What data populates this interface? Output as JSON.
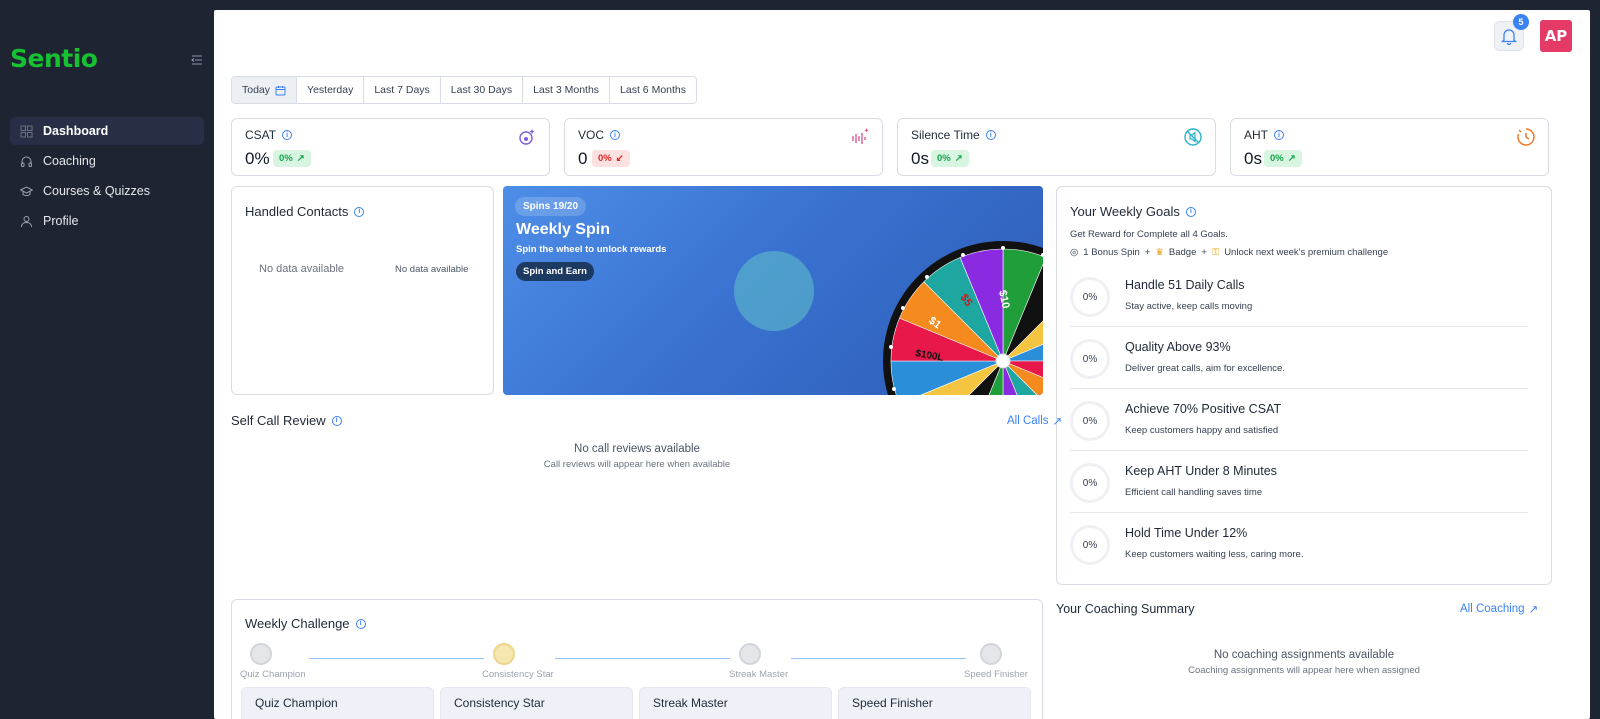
{
  "app": {
    "logo": "Sentio"
  },
  "sidebar": {
    "items": [
      {
        "label": "Dashboard"
      },
      {
        "label": "Coaching"
      },
      {
        "label": "Courses & Quizzes"
      },
      {
        "label": "Profile"
      }
    ]
  },
  "header": {
    "notifications_count": "5",
    "avatar_initials": "AP"
  },
  "range_tabs": [
    "Today",
    "Yesterday",
    "Last 7 Days",
    "Last 30 Days",
    "Last 3 Months",
    "Last 6 Months"
  ],
  "metrics": [
    {
      "title": "CSAT",
      "value": "0%",
      "change": "0%",
      "trend": "up"
    },
    {
      "title": "VOC",
      "value": "0",
      "change": "0%",
      "trend": "down"
    },
    {
      "title": "Silence Time",
      "value": "0s",
      "change": "0%",
      "trend": "up"
    },
    {
      "title": "AHT",
      "value": "0s",
      "change": "0%",
      "trend": "up"
    }
  ],
  "handled_contacts": {
    "title": "Handled Contacts",
    "empty_left": "No data available",
    "empty_right": "No data available"
  },
  "weekly_spin": {
    "badge": "Spins 19/20",
    "title": "Weekly Spin",
    "subtitle": "Spin the wheel to unlock rewards",
    "button": "Spin and Earn",
    "wheel_labels": [
      "$10",
      "ZE",
      "$5",
      "$1",
      "$100L"
    ]
  },
  "weekly_goals": {
    "title": "Your Weekly Goals",
    "subtitle": "Get Reward for Complete all 4 Goals.",
    "rewards": {
      "spin": "1 Bonus Spin",
      "badge": "Badge",
      "unlock": "Unlock next week's premium challenge",
      "plus": "+"
    },
    "items": [
      {
        "progress": "0%",
        "title": "Handle 51 Daily Calls",
        "desc": "Stay active, keep calls moving"
      },
      {
        "progress": "0%",
        "title": "Quality Above 93%",
        "desc": "Deliver great calls, aim for excellence."
      },
      {
        "progress": "0%",
        "title": "Achieve 70% Positive CSAT",
        "desc": "Keep customers happy and satisfied"
      },
      {
        "progress": "0%",
        "title": "Keep AHT Under 8 Minutes",
        "desc": "Efficient call handling saves time"
      },
      {
        "progress": "0%",
        "title": "Hold Time Under 12%",
        "desc": "Keep customers waiting less, caring more."
      }
    ]
  },
  "self_call_review": {
    "title": "Self Call Review",
    "link": "All Calls",
    "empty_title": "No call reviews available",
    "empty_sub": "Call reviews will appear here when available"
  },
  "weekly_challenge": {
    "title": "Weekly Challenge",
    "steps": [
      "Quiz Champion",
      "Consistency Star",
      "Streak Master",
      "Speed Finisher"
    ],
    "cards": [
      "Quiz Champion",
      "Consistency Star",
      "Streak Master",
      "Speed Finisher"
    ]
  },
  "coaching_summary": {
    "title": "Your Coaching Summary",
    "link": "All Coaching",
    "empty_title": "No coaching assignments available",
    "empty_sub": "Coaching assignments will appear here when assigned"
  },
  "colors": {
    "brand": "#16c132",
    "accent": "#3b82f6",
    "avatar": "#e33a66",
    "sidebar": "#1f2433"
  }
}
